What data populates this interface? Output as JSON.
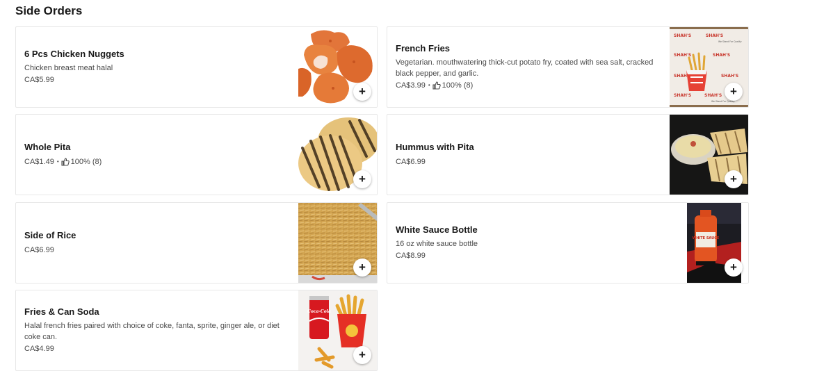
{
  "section": {
    "title": "Side Orders"
  },
  "items": [
    {
      "name": "6 Pcs Chicken Nuggets",
      "description": "Chicken breast meat halal",
      "price": "CA$5.99"
    },
    {
      "name": "French Fries",
      "description": "Vegetarian. mouthwatering thick-cut potato fry, coated with sea salt, cracked black pepper, and garlic.",
      "price": "CA$3.99",
      "rating": "100% (8)"
    },
    {
      "name": "Whole Pita",
      "price": "CA$1.49",
      "rating": "100% (8)"
    },
    {
      "name": "Hummus with Pita",
      "price": "CA$6.99"
    },
    {
      "name": "Side of Rice",
      "price": "CA$6.99"
    },
    {
      "name": "White Sauce Bottle",
      "description": "16 oz white sauce bottle",
      "price": "CA$8.99"
    },
    {
      "name": "Fries & Can Soda",
      "description": "Halal french fries paired with choice of coke, fanta, sprite, ginger ale, or diet coke can.",
      "price": "CA$4.99"
    }
  ],
  "add_label": "+",
  "separator": "•",
  "icons": {
    "add": "plus-icon",
    "rating": "thumbs-up-icon"
  },
  "image_text": {
    "fries_box_brand": "SHAH'S",
    "fries_box_tagline": "We Stand For Quality",
    "sauce_label": "WHITE SAUCE",
    "soda_label": "Coca-Cola"
  }
}
